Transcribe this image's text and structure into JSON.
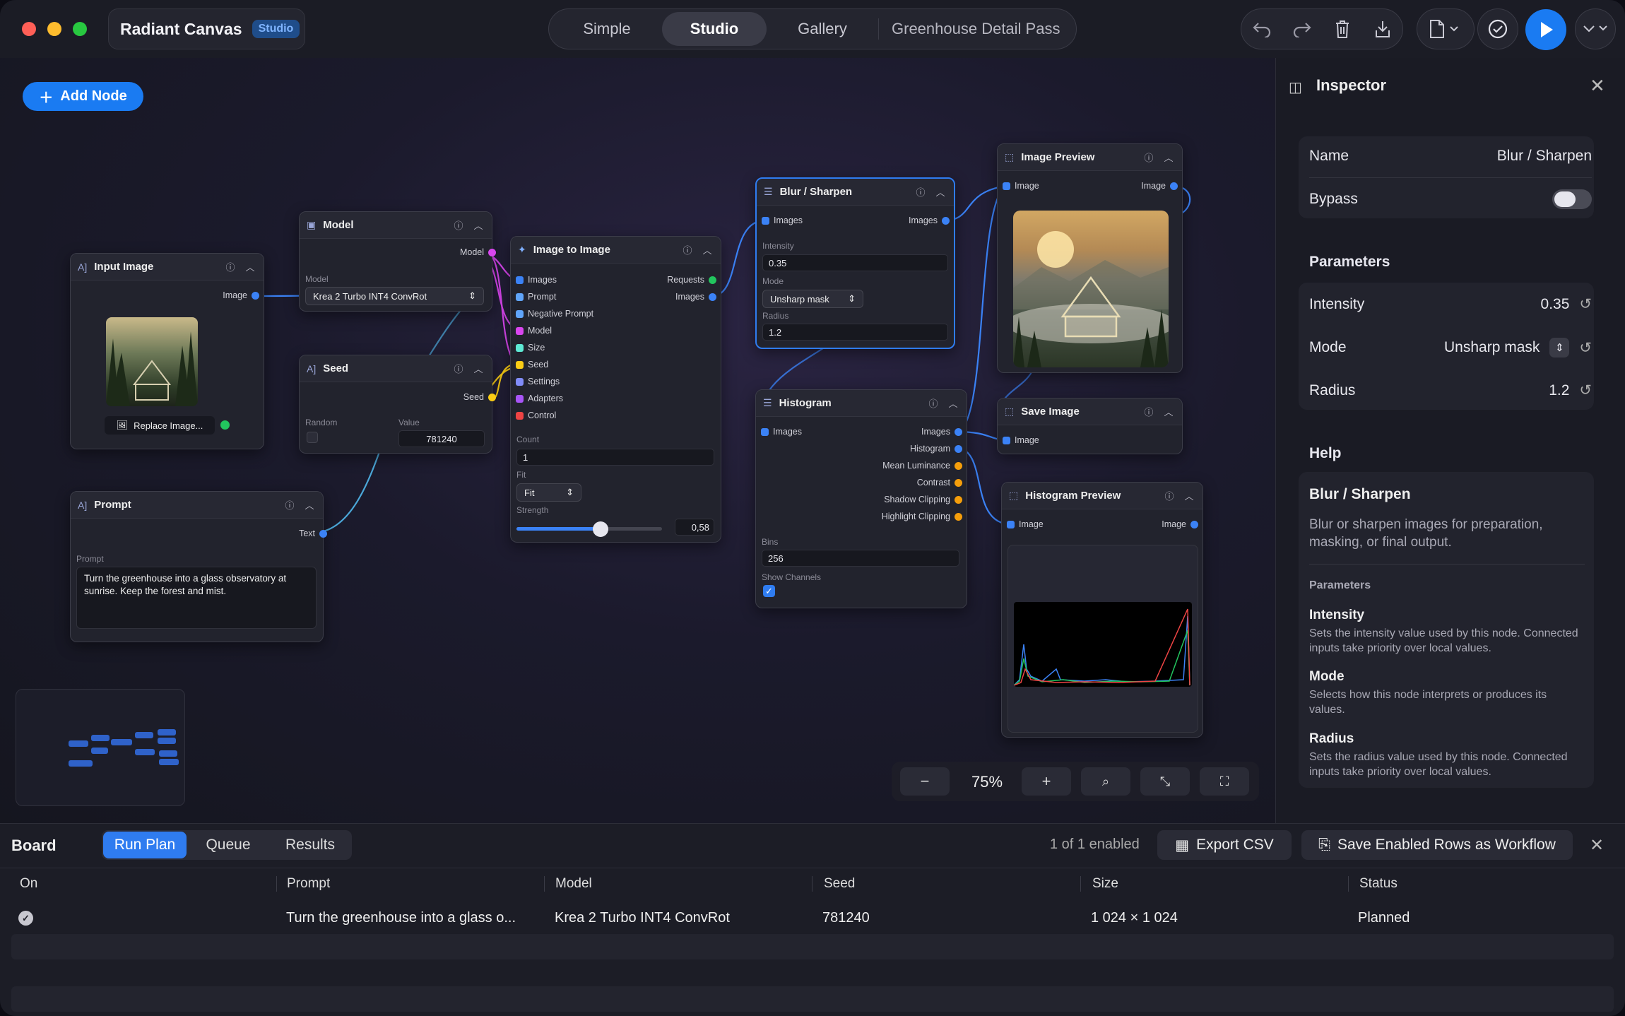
{
  "app": {
    "title": "Radiant Canvas",
    "badge": "Studio"
  },
  "modes": {
    "simple": "Simple",
    "studio": "Studio",
    "gallery": "Gallery",
    "document": "Greenhouse Detail Pass"
  },
  "canvas": {
    "add_node": "Add Node",
    "zoom": "75%"
  },
  "nodes": {
    "input_image": {
      "title": "Input Image",
      "out": "Image",
      "replace": "Replace Image..."
    },
    "model": {
      "title": "Model",
      "out": "Model",
      "label": "Model",
      "value": "Krea 2 Turbo INT4 ConvRot"
    },
    "seed": {
      "title": "Seed",
      "out": "Seed",
      "random": "Random",
      "value_label": "Value",
      "value": "781240"
    },
    "prompt": {
      "title": "Prompt",
      "out": "Text",
      "label": "Prompt",
      "text": "Turn the greenhouse into a glass observatory at sunrise. Keep the forest and mist."
    },
    "img2img": {
      "title": "Image to Image",
      "in_images": "Images",
      "in_prompt": "Prompt",
      "in_neg": "Negative Prompt",
      "in_model": "Model",
      "in_size": "Size",
      "in_seed": "Seed",
      "in_settings": "Settings",
      "in_adapters": "Adapters",
      "in_control": "Control",
      "out_requests": "Requests",
      "out_images": "Images",
      "count_label": "Count",
      "count": "1",
      "fit_label": "Fit",
      "fit": "Fit",
      "strength_label": "Strength",
      "strength": "0,58",
      "strength_frac": 0.58
    },
    "blur": {
      "title": "Blur / Sharpen",
      "in": "Images",
      "out": "Images",
      "intensity_label": "Intensity",
      "intensity": "0.35",
      "mode_label": "Mode",
      "mode": "Unsharp mask",
      "radius_label": "Radius",
      "radius": "1.2"
    },
    "histogram": {
      "title": "Histogram",
      "in": "Images",
      "out_images": "Images",
      "out_histogram": "Histogram",
      "out_mean": "Mean Luminance",
      "out_contrast": "Contrast",
      "out_shadow": "Shadow Clipping",
      "out_highlight": "Highlight Clipping",
      "bins_label": "Bins",
      "bins": "256",
      "show_label": "Show Channels"
    },
    "image_preview": {
      "title": "Image Preview",
      "in": "Image",
      "out": "Image"
    },
    "save_image": {
      "title": "Save Image",
      "in": "Image"
    },
    "histogram_preview": {
      "title": "Histogram Preview",
      "in": "Image",
      "out": "Image"
    }
  },
  "inspector": {
    "title": "Inspector",
    "name_label": "Name",
    "name_value": "Blur / Sharpen",
    "bypass_label": "Bypass",
    "parameters_title": "Parameters",
    "intensity_label": "Intensity",
    "intensity": "0.35",
    "mode_label": "Mode",
    "mode": "Unsharp mask",
    "radius_label": "Radius",
    "radius": "1.2",
    "help_title": "Help",
    "help_node": "Blur / Sharpen",
    "help_desc": "Blur or sharpen images for preparation, masking, or final output.",
    "help_params": "Parameters",
    "h_intensity": "Intensity",
    "h_intensity_desc": "Sets the intensity value used by this node. Connected inputs take priority over local values.",
    "h_mode": "Mode",
    "h_mode_desc": "Selects how this node interprets or produces its values.",
    "h_radius": "Radius",
    "h_radius_desc": "Sets the radius value used by this node. Connected inputs take priority over local values."
  },
  "board": {
    "title": "Board",
    "tab_run": "Run Plan",
    "tab_queue": "Queue",
    "tab_results": "Results",
    "enabled": "1 of 1 enabled",
    "export": "Export CSV",
    "save_rows": "Save Enabled Rows as Workflow",
    "columns": {
      "on": "On",
      "prompt": "Prompt",
      "model": "Model",
      "seed": "Seed",
      "size": "Size",
      "status": "Status"
    },
    "row": {
      "prompt": "Turn the greenhouse into a glass o...",
      "model": "Krea 2 Turbo INT4 ConvRot",
      "seed": "781240",
      "size": "1 024 × 1 024",
      "status": "Planned"
    }
  },
  "colors": {
    "accent": "#1a7bf2",
    "image_port": "#3b82f6",
    "model_port": "#d946ef",
    "seed_port": "#facc15",
    "requests_port": "#22c55e",
    "orange_port": "#f59e0b"
  }
}
